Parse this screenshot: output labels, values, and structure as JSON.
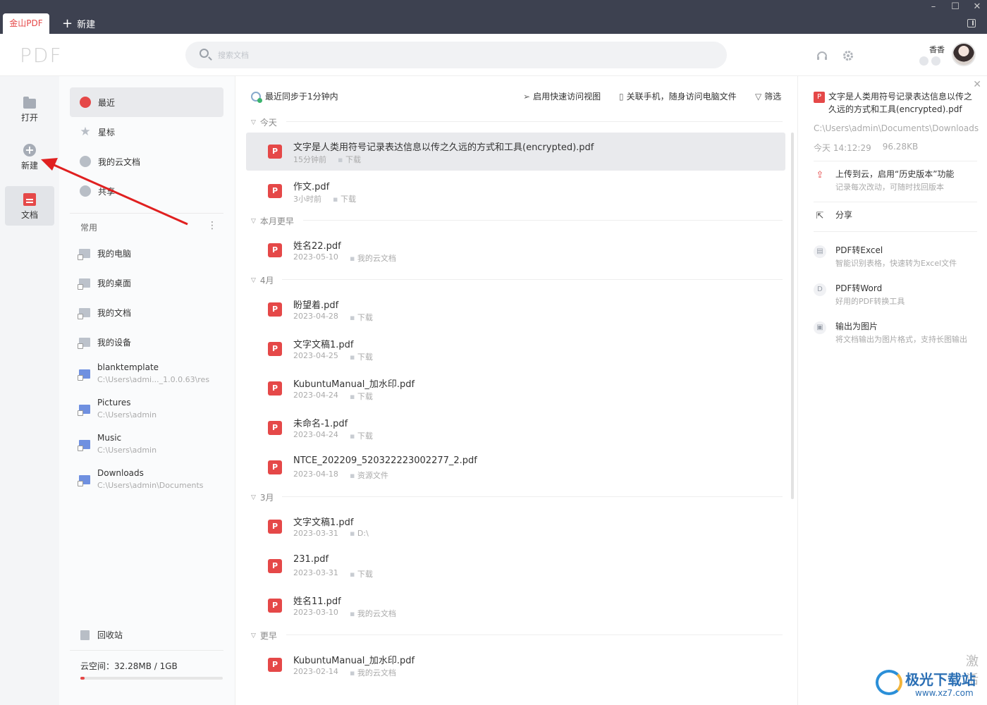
{
  "titlebar": {
    "active_tab": "金山PDF",
    "new_tab": "新建",
    "controls": {
      "minimize": "–",
      "maximize": "☐",
      "close": "✕"
    }
  },
  "header": {
    "logo": "PDF",
    "search_placeholder": "搜索文档",
    "username": "香香"
  },
  "rail": {
    "items": [
      {
        "label": "打开",
        "icon": "folder-icon"
      },
      {
        "label": "新建",
        "icon": "plus-circle-icon"
      },
      {
        "label": "文档",
        "icon": "document-icon"
      }
    ]
  },
  "nav": {
    "items": [
      {
        "label": "最近",
        "icon": "clock-icon"
      },
      {
        "label": "星标",
        "icon": "star-icon"
      },
      {
        "label": "我的云文档",
        "icon": "cloud-box-icon"
      },
      {
        "label": "共享",
        "icon": "people-icon"
      }
    ],
    "section_title": "常用",
    "section_more": "⋮",
    "favorites": [
      {
        "name": "我的电脑",
        "path": ""
      },
      {
        "name": "我的桌面",
        "path": ""
      },
      {
        "name": "我的文档",
        "path": ""
      },
      {
        "name": "我的设备",
        "path": ""
      },
      {
        "name": "blanktemplate",
        "path": "C:\\Users\\admi..._1.0.0.63\\res"
      },
      {
        "name": "Pictures",
        "path": "C:\\Users\\admin"
      },
      {
        "name": "Music",
        "path": "C:\\Users\\admin"
      },
      {
        "name": "Downloads",
        "path": "C:\\Users\\admin\\Documents"
      }
    ],
    "trash": "回收站",
    "storage": "云空间：32.28MB / 1GB",
    "storage_used_fraction": 0.0315
  },
  "main": {
    "sync_status": "最近同步于1分钟内",
    "actions": {
      "quick_view": "启用快速访问视图",
      "link_phone": "关联手机，随身访问电脑文件",
      "filter": "筛选"
    },
    "groups": [
      {
        "title": "今天",
        "files": [
          {
            "name": "文字是人类用符号记录表达信息以传之久远的方式和工具(encrypted).pdf",
            "date": "15分钟前",
            "location": "下载"
          },
          {
            "name": "作文.pdf",
            "date": "3小时前",
            "location": "下载"
          }
        ]
      },
      {
        "title": "本月更早",
        "files": [
          {
            "name": "姓名22.pdf",
            "date": "2023-05-10",
            "location": "我的云文档"
          }
        ]
      },
      {
        "title": "4月",
        "files": [
          {
            "name": "盼望着.pdf",
            "date": "2023-04-28",
            "location": "下载"
          },
          {
            "name": "文字文稿1.pdf",
            "date": "2023-04-25",
            "location": "下载"
          },
          {
            "name": "KubuntuManual_加水印.pdf",
            "date": "2023-04-24",
            "location": "下载"
          },
          {
            "name": "未命名-1.pdf",
            "date": "2023-04-24",
            "location": "下载"
          },
          {
            "name": "NTCE_202209_520322223002277_2.pdf",
            "date": "2023-04-18",
            "location": "资源文件"
          }
        ]
      },
      {
        "title": "3月",
        "files": [
          {
            "name": "文字文稿1.pdf",
            "date": "2023-03-31",
            "location": "D:\\"
          },
          {
            "name": "231.pdf",
            "date": "2023-03-31",
            "location": "下载"
          },
          {
            "name": "姓名11.pdf",
            "date": "2023-03-10",
            "location": "我的云文档"
          }
        ]
      },
      {
        "title": "更早",
        "files": [
          {
            "name": "KubuntuManual_加水印.pdf",
            "date": "2023-02-14",
            "location": "我的云文档"
          }
        ]
      }
    ]
  },
  "panel": {
    "title": "文字是人类用符号记录表达信息以传之久远的方式和工具(encrypted).pdf",
    "path": "C:\\Users\\admin\\Documents\\Downloads",
    "time": "今天 14:12:29",
    "size": "96.28KB",
    "upload_title": "上传到云，启用“历史版本”功能",
    "upload_sub": "记录每次改动，可随时找回版本",
    "share": "分享",
    "tools": [
      {
        "title": "PDF转Excel",
        "sub": "智能识别表格，快速转为Excel文件"
      },
      {
        "title": "PDF转Word",
        "sub": "好用的PDF转换工具"
      },
      {
        "title": "输出为图片",
        "sub": "将文档输出为图片格式，支持长图输出"
      }
    ]
  },
  "watermark": {
    "brand": "极光下载站",
    "url": "www.xz7.com",
    "side_text": "激活"
  },
  "colors": {
    "accent": "#e54848",
    "titlebar": "#3d4150",
    "selected": "#e9eaed",
    "annotation_arrow": "#e02020"
  }
}
